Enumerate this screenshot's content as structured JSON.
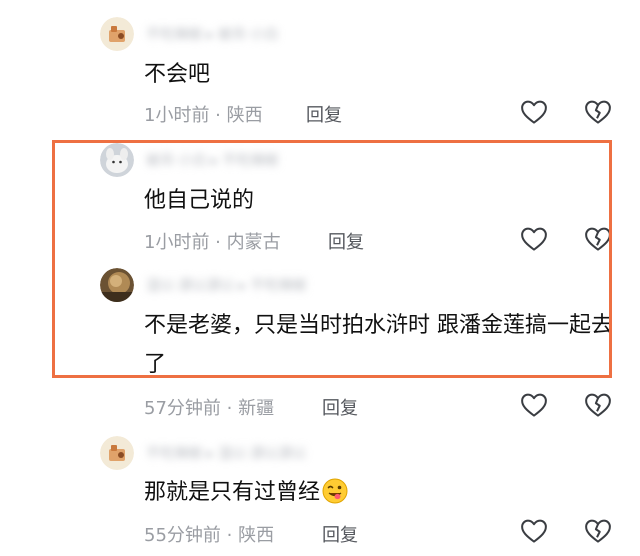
{
  "comments": [
    {
      "name_blurred": "不吃辣椒 ▸ 被吊·小白",
      "text": "不会吧",
      "time": "1小时前",
      "location": "陕西",
      "reply_label": "回复"
    },
    {
      "name_blurred": "被吊·小白 ▸ 不吃辣椒",
      "text": "他自己说的",
      "time": "1小时前",
      "location": "内蒙古",
      "reply_label": "回复"
    },
    {
      "name_blurred": "湿以·源以源以 ▸ 不吃辣椒",
      "text": "不是老婆，只是当时拍水浒时 跟潘金莲搞一起去了",
      "time": "57分钟前",
      "location": "新疆",
      "reply_label": "回复"
    },
    {
      "name_blurred": "不吃辣椒 ▸ 湿以·源以源以",
      "text": "那就是只有过曾经",
      "time": "55分钟前",
      "location": "陕西",
      "reply_label": "回复"
    }
  ],
  "meta_separator": " · ",
  "icons": {
    "like": "heart-outline-icon",
    "dislike": "broken-heart-outline-icon",
    "emoji": "winking-tongue-emoji-icon"
  },
  "colors": {
    "highlight_border": "#ee7042",
    "text": "#111111",
    "meta": "#9a9da3",
    "icon_stroke": "#3a3d42"
  }
}
